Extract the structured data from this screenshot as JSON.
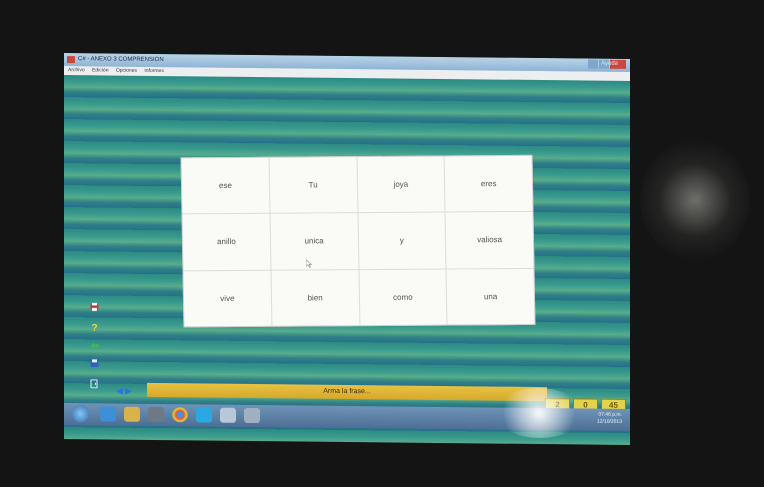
{
  "window": {
    "title": "C# - ANEXO 3 COMPRENSIÓN",
    "help_menu": "Ayuda"
  },
  "menubar": {
    "items": [
      "Archivo",
      "Edición",
      "Opciones",
      "Informes"
    ]
  },
  "word_grid": {
    "rows": [
      [
        "ese",
        "Tu",
        "joya",
        "eres"
      ],
      [
        "anillo",
        "unica",
        "y",
        "valiosa"
      ],
      [
        "vive",
        "bien",
        "como",
        "una"
      ]
    ]
  },
  "status": {
    "instruction": "Arma la frase..."
  },
  "counters": [
    "2",
    "0",
    "45"
  ],
  "clock": {
    "time": "07:46 p.m.",
    "date": "12/10/2013"
  },
  "colors": {
    "status_bar": "#e0b838",
    "counter_bg": "#e4d34a",
    "cell_bg": "#fafaf6"
  },
  "icons": [
    "printer-icon",
    "help-icon",
    "back-icon",
    "save-icon",
    "exit-icon",
    "arrow-left-icon",
    "arrow-right-icon"
  ]
}
